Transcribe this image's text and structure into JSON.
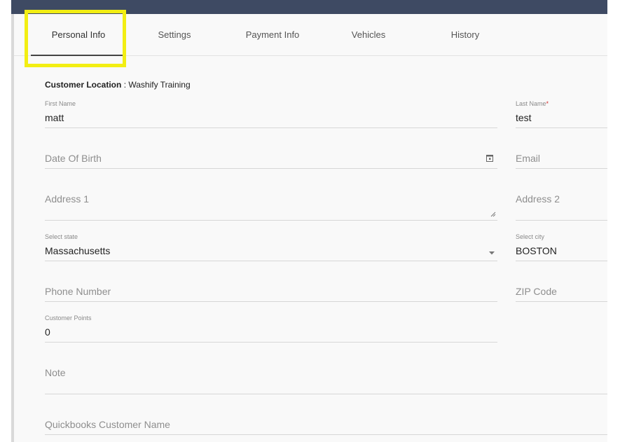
{
  "tabs": [
    {
      "label": "Personal Info",
      "active": true
    },
    {
      "label": "Settings"
    },
    {
      "label": "Payment Info"
    },
    {
      "label": "Vehicles"
    },
    {
      "label": "History"
    }
  ],
  "customer_location": {
    "label": "Customer Location",
    "separator": ":",
    "value": "Washify Training"
  },
  "fields": {
    "first_name": {
      "label": "First Name",
      "value": "matt"
    },
    "last_name": {
      "label": "Last Name",
      "required_mark": "*",
      "value": "test"
    },
    "date_of_birth": {
      "placeholder": "Date Of Birth"
    },
    "email": {
      "placeholder": "Email"
    },
    "address1": {
      "placeholder": "Address 1"
    },
    "address2": {
      "placeholder": "Address 2"
    },
    "state": {
      "label": "Select state",
      "value": "Massachusetts"
    },
    "city": {
      "label": "Select city",
      "value": "BOSTON"
    },
    "phone": {
      "placeholder": "Phone Number"
    },
    "zip": {
      "placeholder": "ZIP Code"
    },
    "points": {
      "label": "Customer Points",
      "value": "0"
    },
    "note": {
      "placeholder": "Note"
    },
    "qb_name": {
      "placeholder": "Quickbooks Customer Name"
    }
  },
  "colors": {
    "highlight": "#f2ee13",
    "required": "#d32f2f",
    "banner": "#3e4a63"
  }
}
